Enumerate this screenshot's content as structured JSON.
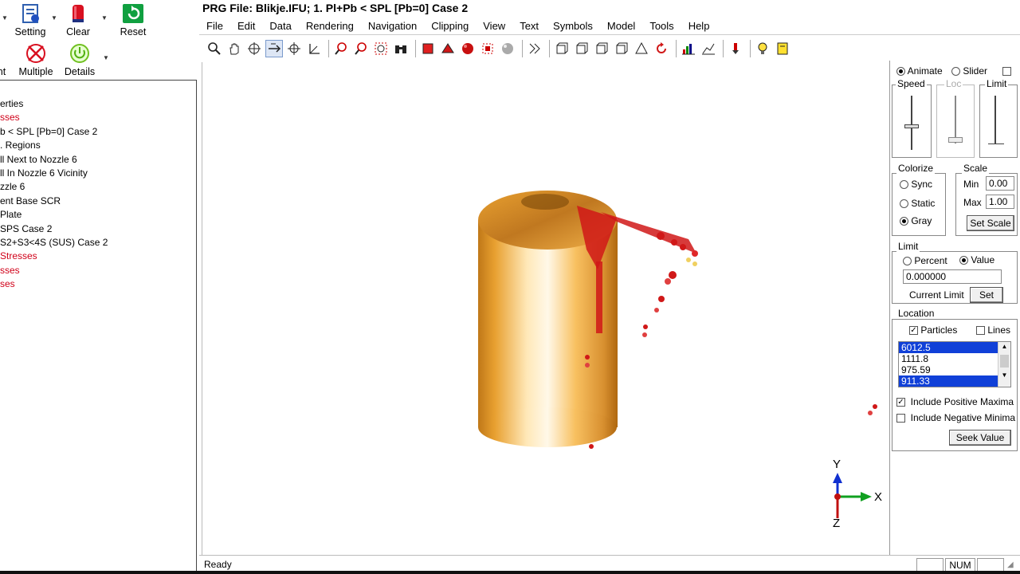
{
  "title": "PRG File: Blikje.IFU; 1. Pl+Pb < SPL [Pb=0] Case 2",
  "ribbon": {
    "partial_top_label": "",
    "setting": "Setting",
    "clear": "Clear",
    "reset": "Reset",
    "partial_left_label": "nt",
    "multiple": "Multiple",
    "details": "Details"
  },
  "tree": {
    "items": [
      {
        "text": "erties",
        "red": false
      },
      {
        "text": "sses",
        "red": true
      },
      {
        "text": "b < SPL [Pb=0] Case 2",
        "red": false
      },
      {
        "text": ". Regions",
        "red": false
      },
      {
        "text": "ll Next to Nozzle 6",
        "red": false
      },
      {
        "text": "ll In Nozzle 6 Vicinity",
        "red": false
      },
      {
        "text": "zzle 6",
        "red": false
      },
      {
        "text": "ent Base SCR",
        "red": false
      },
      {
        "text": " Plate",
        "red": false
      },
      {
        "text": " SPS Case 2",
        "red": false
      },
      {
        "text": "S2+S3<4S (SUS) Case 2",
        "red": false
      },
      {
        "text": "Stresses",
        "red": true
      },
      {
        "text": "sses",
        "red": true
      },
      {
        "text": "ses",
        "red": true
      }
    ]
  },
  "menu": [
    "File",
    "Edit",
    "Data",
    "Rendering",
    "Navigation",
    "Clipping",
    "View",
    "Text",
    "Symbols",
    "Model",
    "Tools",
    "Help"
  ],
  "panel": {
    "animate": "Animate",
    "slider": "Slider",
    "speed": "Speed",
    "loc": "Loc",
    "limit_slider": "Limit",
    "colorize": {
      "title": "Colorize",
      "sync": "Sync",
      "static": "Static",
      "gray": "Gray"
    },
    "scale": {
      "title": "Scale",
      "min_label": "Min",
      "min_value": "0.00",
      "max_label": "Max",
      "max_value": "1.00",
      "set_scale": "Set Scale"
    },
    "limit": {
      "title": "Limit",
      "percent": "Percent",
      "value": "Value",
      "field": "0.000000",
      "current_limit": "Current Limit",
      "set": "Set"
    },
    "location": {
      "title": "Location",
      "particles": "Particles",
      "lines": "Lines",
      "values": [
        "6012.5",
        "1111.8",
        "975.59",
        "911.33"
      ],
      "selected": [
        true,
        false,
        false,
        true
      ],
      "include_pos": "Include Positive Maxima",
      "include_neg": "Include Negative Minima",
      "seek": "Seek Value"
    }
  },
  "axes": {
    "y": "Y",
    "x": "X",
    "z": "Z"
  },
  "status": {
    "text": "Ready",
    "num": "NUM"
  },
  "colors": {
    "accent_red": "#d00018",
    "cylinder": "#e8a030",
    "selection": "#1040d8"
  }
}
